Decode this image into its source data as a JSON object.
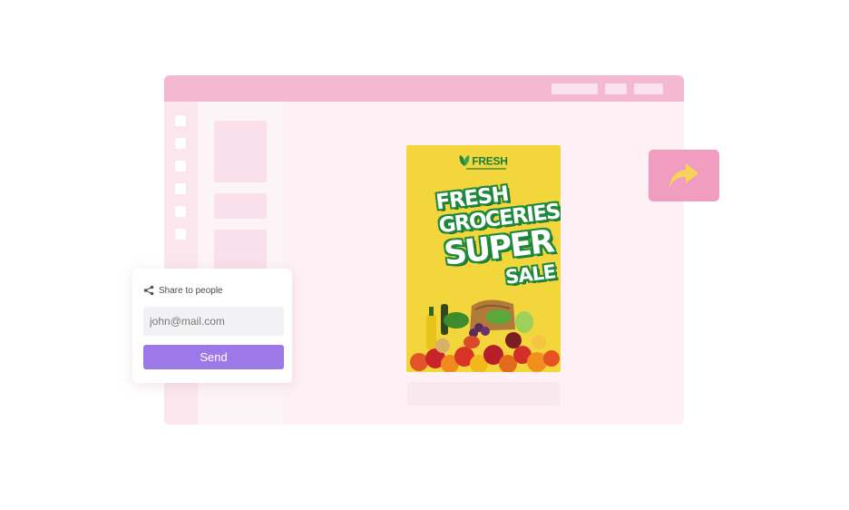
{
  "poster": {
    "brand": "FRESH",
    "headline": [
      "FRESH",
      "GROCERIES",
      "SUPER",
      "SALE"
    ]
  },
  "share": {
    "heading": "Share to people",
    "email_value": "john@mail.com",
    "send_label": "Send"
  },
  "icons": {
    "share": "share-icon",
    "forward_arrow": "forward-arrow-icon",
    "leaf": "leaf-icon"
  },
  "colors": {
    "titlebar": "#f4b8d0",
    "window_bg": "#fdf1f6",
    "poster_bg": "#f2d63c",
    "poster_green": "#1e8a3d",
    "share_button": "#f19dbf",
    "arrow": "#f7d35a",
    "send_button": "#9d78e9"
  }
}
